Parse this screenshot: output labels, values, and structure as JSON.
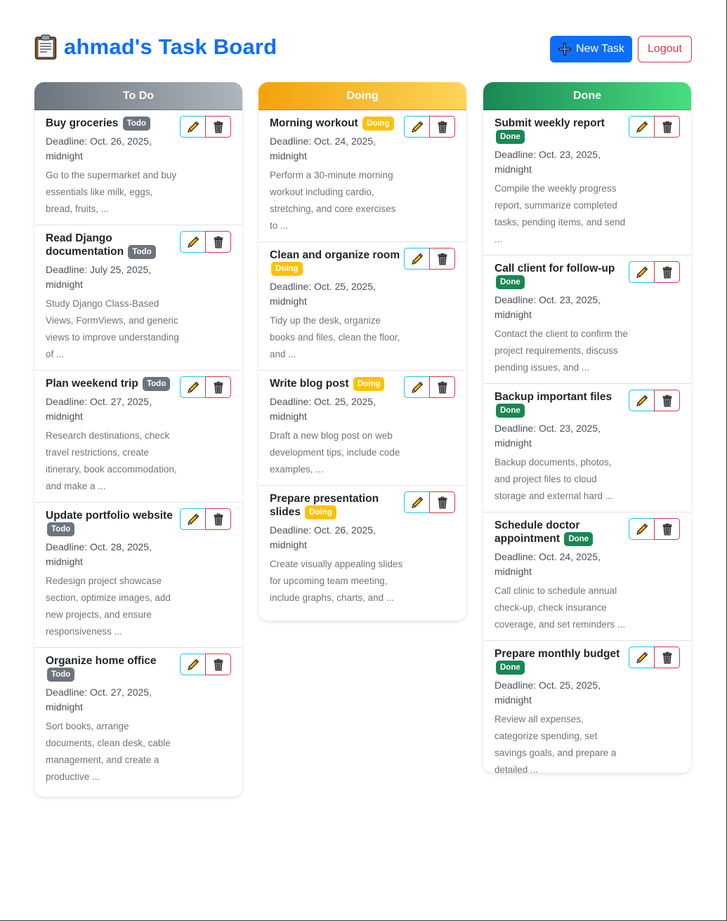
{
  "header": {
    "title_icon": "clipboard-icon",
    "title": "ahmad's Task Board",
    "new_task_label": "New Task",
    "logout_label": "Logout"
  },
  "colors": {
    "primary": "#0d6efd",
    "danger": "#dc3545",
    "info": "#0dcaf0",
    "todo": "#6c757d",
    "doing": "#ffc107",
    "done": "#198754"
  },
  "columns": [
    {
      "key": "todo",
      "title": "To Do",
      "tasks": [
        {
          "title": "Buy groceries",
          "badge": "Todo",
          "deadline": "Deadline: Oct. 26, 2025, midnight",
          "description": "Go to the supermarket and buy essentials like milk, eggs, bread, fruits, ..."
        },
        {
          "title": "Read Django documentation",
          "badge": "Todo",
          "deadline": "Deadline: July 25, 2025, midnight",
          "description": "Study Django Class-Based Views, FormViews, and generic views to improve understanding of ..."
        },
        {
          "title": "Plan weekend trip",
          "badge": "Todo",
          "deadline": "Deadline: Oct. 27, 2025, midnight",
          "description": "Research destinations, check travel restrictions, create itinerary, book accommodation, and make a ..."
        },
        {
          "title": "Update portfolio website",
          "badge": "Todo",
          "deadline": "Deadline: Oct. 28, 2025, midnight",
          "description": "Redesign project showcase section, optimize images, add new projects, and ensure responsiveness ..."
        },
        {
          "title": "Organize home office",
          "badge": "Todo",
          "deadline": "Deadline: Oct. 27, 2025, midnight",
          "description": "Sort books, arrange documents, clean desk, cable management, and create a productive ..."
        }
      ]
    },
    {
      "key": "doing",
      "title": "Doing",
      "tasks": [
        {
          "title": "Morning workout",
          "badge": "Doing",
          "deadline": "Deadline: Oct. 24, 2025, midnight",
          "description": "Perform a 30-minute morning workout including cardio, stretching, and core exercises to ..."
        },
        {
          "title": "Clean and organize room",
          "badge": "Doing",
          "deadline": "Deadline: Oct. 25, 2025, midnight",
          "description": "Tidy up the desk, organize books and files, clean the floor, and ..."
        },
        {
          "title": "Write blog post",
          "badge": "Doing",
          "deadline": "Deadline: Oct. 25, 2025, midnight",
          "description": "Draft a new blog post on web development tips, include code examples, ..."
        },
        {
          "title": "Prepare presentation slides",
          "badge": "Doing",
          "deadline": "Deadline: Oct. 26, 2025, midnight",
          "description": "Create visually appealing slides for upcoming team meeting, include graphs, charts, and ..."
        }
      ]
    },
    {
      "key": "done",
      "title": "Done",
      "tasks": [
        {
          "title": "Submit weekly report",
          "badge": "Done",
          "deadline": "Deadline: Oct. 23, 2025, midnight",
          "description": "Compile the weekly progress report, summarize completed tasks, pending items, and send ..."
        },
        {
          "title": "Call client for follow-up",
          "badge": "Done",
          "deadline": "Deadline: Oct. 23, 2025, midnight",
          "description": "Contact the client to confirm the project requirements, discuss pending issues, and ..."
        },
        {
          "title": "Backup important files",
          "badge": "Done",
          "deadline": "Deadline: Oct. 23, 2025, midnight",
          "description": "Backup documents, photos, and project files to cloud storage and external hard ..."
        },
        {
          "title": "Schedule doctor appointment",
          "badge": "Done",
          "deadline": "Deadline: Oct. 24, 2025, midnight",
          "description": "Call clinic to schedule annual check-up, check insurance coverage, and set reminders ..."
        },
        {
          "title": "Prepare monthly budget",
          "badge": "Done",
          "deadline": "Deadline: Oct. 25, 2025, midnight",
          "description": "Review all expenses, categorize spending, set savings goals, and prepare a detailed ..."
        }
      ]
    }
  ],
  "card_icons": {
    "edit": "pencil-icon",
    "delete": "trash-icon"
  }
}
